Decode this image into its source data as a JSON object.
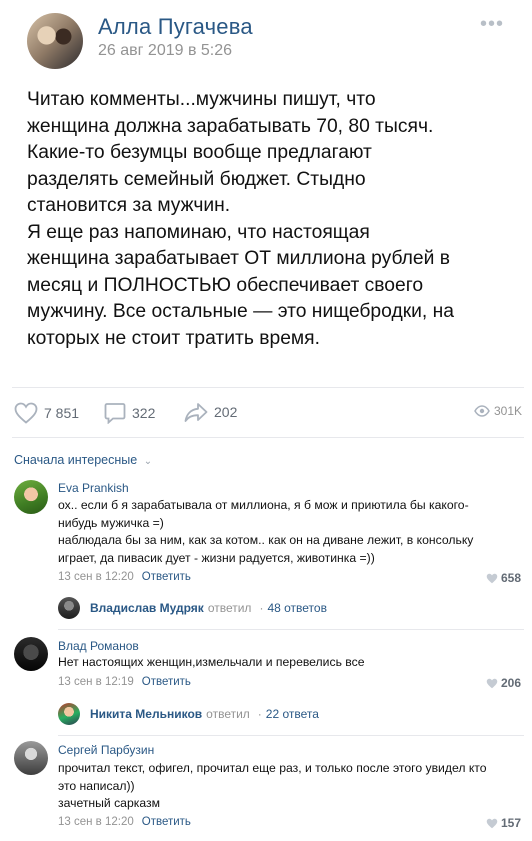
{
  "post": {
    "author": "Алла Пугачева",
    "date": "26 авг 2019 в 5:26",
    "more": "•••",
    "text_lines": [
      "Читаю комменты...мужчины пишут, что",
      "женщина должна зарабатывать 70, 80 тысяч.",
      "Какие-то безумцы вообще предлагают",
      "разделять семейный бюджет. Стыдно",
      "становится за мужчин.",
      "Я еще раз напоминаю, что настоящая",
      "женщина зарабатывает ОТ миллиона рублей в",
      "месяц и ПОЛНОСТЬЮ обеспечивает своего",
      "мужчину. Все остальные — это нищебродки, на",
      "которых не стоит тратить время."
    ],
    "actions": {
      "likes": "7 851",
      "comments": "322",
      "shares": "202",
      "views": "301K"
    }
  },
  "comments_section": {
    "sort_label": "Сначала интересные",
    "comments": [
      {
        "author": "Eva Prankish",
        "lines": [
          "ох.. если б я зарабатывала от миллиона, я б мож и приютила бы какого-",
          "нибудь мужичка =)",
          "наблюдала бы за ним, как за котом.. как он на диване лежит, в консольку",
          "играет, да пивасик дует - жизни радуется, животинка =))"
        ],
        "date": "13 сен в 12:20",
        "reply_label": "Ответить",
        "likes": "658",
        "thread": {
          "name": "Владислав Мудряк",
          "replied": "ответил",
          "count": "48 ответов"
        }
      },
      {
        "author": "Влад Романов",
        "lines": [
          "Нет настоящих женщин,измельчали и перевелись все"
        ],
        "date": "13 сен в 12:19",
        "reply_label": "Ответить",
        "likes": "206",
        "thread": {
          "name": "Никита Мельников",
          "replied": "ответил",
          "count": "22 ответа"
        }
      },
      {
        "author": "Сергей Парбузин",
        "lines": [
          "прочитал текст, офигел, прочитал еще раз, и только после этого увидел кто",
          "это написал))",
          "зачетный сарказм"
        ],
        "date": "13 сен в 12:20",
        "reply_label": "Ответить",
        "likes": "157"
      }
    ]
  },
  "colors": {
    "link": "#2a5885",
    "muted": "#939393",
    "divider": "#e7e8ec",
    "icon": "#aab2bd"
  }
}
